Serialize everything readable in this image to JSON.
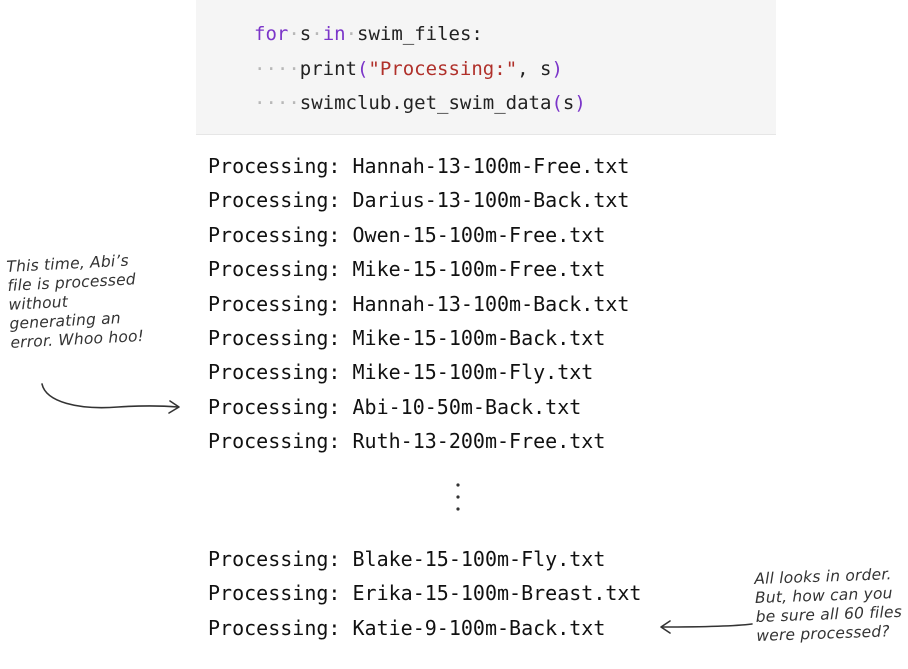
{
  "code": {
    "line1": {
      "kw_for": "for",
      "var": "s",
      "kw_in": "in",
      "iter": "swim_files:"
    },
    "line2": {
      "indent": "····",
      "func": "print",
      "open": "(",
      "arg_str": "\"Processing:\"",
      "rest": ", s",
      "close": ")"
    },
    "line3": {
      "indent": "····",
      "call": "swimclub.get_swim_data",
      "open": "(",
      "arg": "s",
      "close": ")"
    }
  },
  "output_lines_top": [
    "Processing: Hannah-13-100m-Free.txt",
    "Processing: Darius-13-100m-Back.txt",
    "Processing: Owen-15-100m-Free.txt",
    "Processing: Mike-15-100m-Free.txt",
    "Processing: Hannah-13-100m-Back.txt",
    "Processing: Mike-15-100m-Back.txt",
    "Processing: Mike-15-100m-Fly.txt",
    "Processing: Abi-10-50m-Back.txt",
    "Processing: Ruth-13-200m-Free.txt"
  ],
  "output_lines_bottom": [
    "Processing: Blake-15-100m-Fly.txt",
    "Processing: Erika-15-100m-Breast.txt",
    "Processing: Katie-9-100m-Back.txt"
  ],
  "annotations": {
    "left": [
      "This time, Abi’s",
      "file is processed",
      "without",
      "generating an",
      "error. Whoo hoo!"
    ],
    "right": [
      "All looks in order.",
      "But, how can you",
      "be sure all 60 files",
      "were processed?"
    ]
  }
}
